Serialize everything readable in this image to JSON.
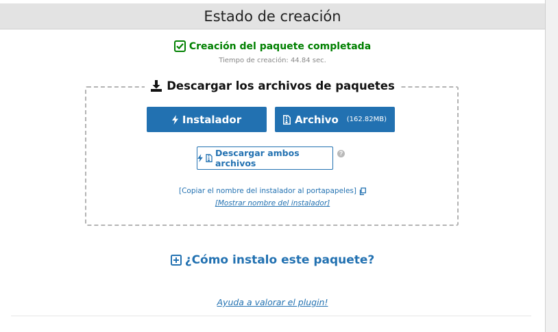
{
  "header": {
    "title": "Estado de creación"
  },
  "status": {
    "message": "Creación del paquete completada",
    "time": "Tiempo de creación: 44.84 sec.",
    "color": "#008000"
  },
  "download": {
    "title": "Descargar los archivos de paquetes",
    "installer_label": "Instalador",
    "archive_label": "Archivo",
    "archive_size": "(162.82MB)",
    "both_label": "Descargar ambos archivos",
    "help_icon": "?",
    "copy_link": "[Copiar el nombre del instalador al portapapeles]",
    "show_link": "[Mostrar nombre del instalador]"
  },
  "howto": {
    "label": "¿Cómo instalo este paquete?"
  },
  "footer": {
    "rate_link": "Ayuda a valorar el plugin!"
  },
  "colors": {
    "accent": "#2271b1",
    "success": "#008000"
  },
  "icons": [
    "check-square-icon",
    "download-icon",
    "bolt-icon",
    "file-archive-icon",
    "copy-icon",
    "plus-square-icon",
    "help-icon"
  ]
}
